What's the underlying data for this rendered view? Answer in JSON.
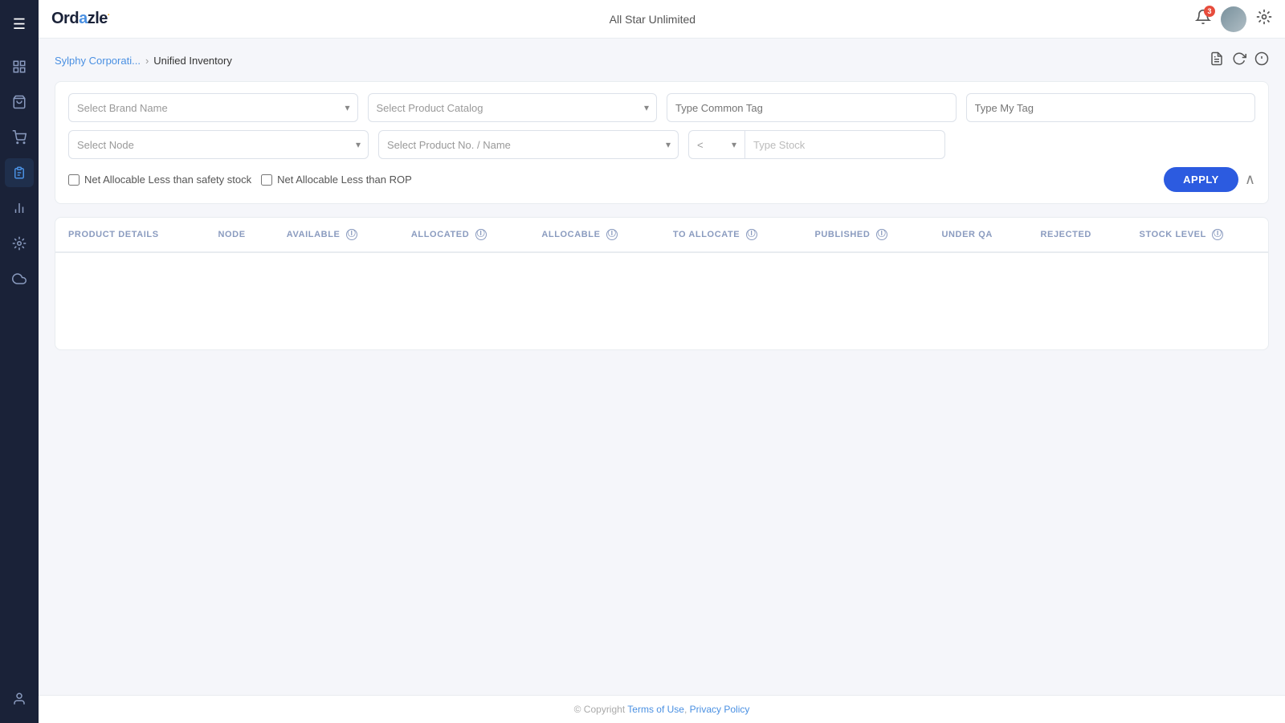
{
  "app": {
    "name": "Ordazle",
    "name_suffix": "·",
    "company": "All Star Unlimited"
  },
  "notifications": {
    "count": "3"
  },
  "breadcrumb": {
    "parent": "Sylphy Corporati...",
    "separator": "›",
    "current": "Unified Inventory"
  },
  "filters": {
    "brand_placeholder": "Select Brand Name",
    "catalog_placeholder": "Select Product Catalog",
    "common_tag_placeholder": "Type Common Tag",
    "my_tag_placeholder": "Type My Tag",
    "node_placeholder": "Select Node",
    "product_placeholder": "Select Product No. / Name",
    "stock_operator_options": [
      "<",
      "≤",
      "=",
      "≥",
      ">"
    ],
    "stock_operator_selected": "<",
    "stock_placeholder": "Type Stock",
    "checkbox1_label": "Net Allocable Less than safety stock",
    "checkbox2_label": "Net Allocable Less than ROP",
    "apply_label": "APPLY"
  },
  "table": {
    "columns": [
      {
        "key": "product_details",
        "label": "PRODUCT DETAILS",
        "has_info": false
      },
      {
        "key": "node",
        "label": "NODE",
        "has_info": false
      },
      {
        "key": "available",
        "label": "AVAILABLE",
        "has_info": true
      },
      {
        "key": "allocated",
        "label": "ALLOCATED",
        "has_info": true
      },
      {
        "key": "allocable",
        "label": "ALLOCABLE",
        "has_info": true
      },
      {
        "key": "to_allocate",
        "label": "TO ALLOCATE",
        "has_info": true
      },
      {
        "key": "published",
        "label": "PUBLISHED",
        "has_info": true
      },
      {
        "key": "under_qa",
        "label": "UNDER QA",
        "has_info": false
      },
      {
        "key": "rejected",
        "label": "REJECTED",
        "has_info": false
      },
      {
        "key": "stock_level",
        "label": "STOCK LEVEL",
        "has_info": true
      }
    ],
    "rows": []
  },
  "footer": {
    "copyright": "© Copyright",
    "terms_label": "Terms of Use",
    "privacy_label": "Privacy Policy",
    "separator": ","
  },
  "sidebar": {
    "items": [
      {
        "icon": "☰",
        "name": "hamburger-icon",
        "label": "Menu"
      },
      {
        "icon": "⊞",
        "name": "dashboard-icon",
        "label": "Dashboard"
      },
      {
        "icon": "📦",
        "name": "orders-icon",
        "label": "Orders"
      },
      {
        "icon": "🛒",
        "name": "cart-icon",
        "label": "Cart"
      },
      {
        "icon": "📋",
        "name": "inventory-icon",
        "label": "Inventory",
        "active": true
      },
      {
        "icon": "📄",
        "name": "reports-icon",
        "label": "Reports"
      },
      {
        "icon": "🔧",
        "name": "tools-icon",
        "label": "Tools"
      },
      {
        "icon": "☁",
        "name": "cloud-icon",
        "label": "Cloud"
      },
      {
        "icon": "👤",
        "name": "profile-icon",
        "label": "Profile"
      }
    ]
  }
}
